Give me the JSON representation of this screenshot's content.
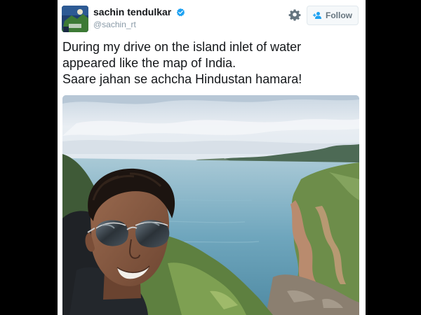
{
  "tweet": {
    "author": {
      "display_name": "sachin tendulkar",
      "handle": "@sachin_rt",
      "verified": true,
      "avatar_icon": "avatar-image"
    },
    "actions": {
      "settings_icon": "gear-icon",
      "follow_icon": "add-user-icon",
      "follow_label": "Follow"
    },
    "text_lines": [
      "During my drive on the island inlet of water",
      "appeared like the map of India.",
      "Saare jahan se achcha Hindustan hamara!"
    ],
    "media": {
      "type": "photo",
      "subject": "selfie-with-sunglasses-over-coastal-inlet"
    }
  },
  "colors": {
    "background": "#000000",
    "card": "#ffffff",
    "name": "#14171a",
    "handle": "#8899a6",
    "verified": "#1da1f2",
    "follow_bg": "#f5f8fa",
    "follow_text": "#66757f",
    "border": "#e1e8ed"
  }
}
